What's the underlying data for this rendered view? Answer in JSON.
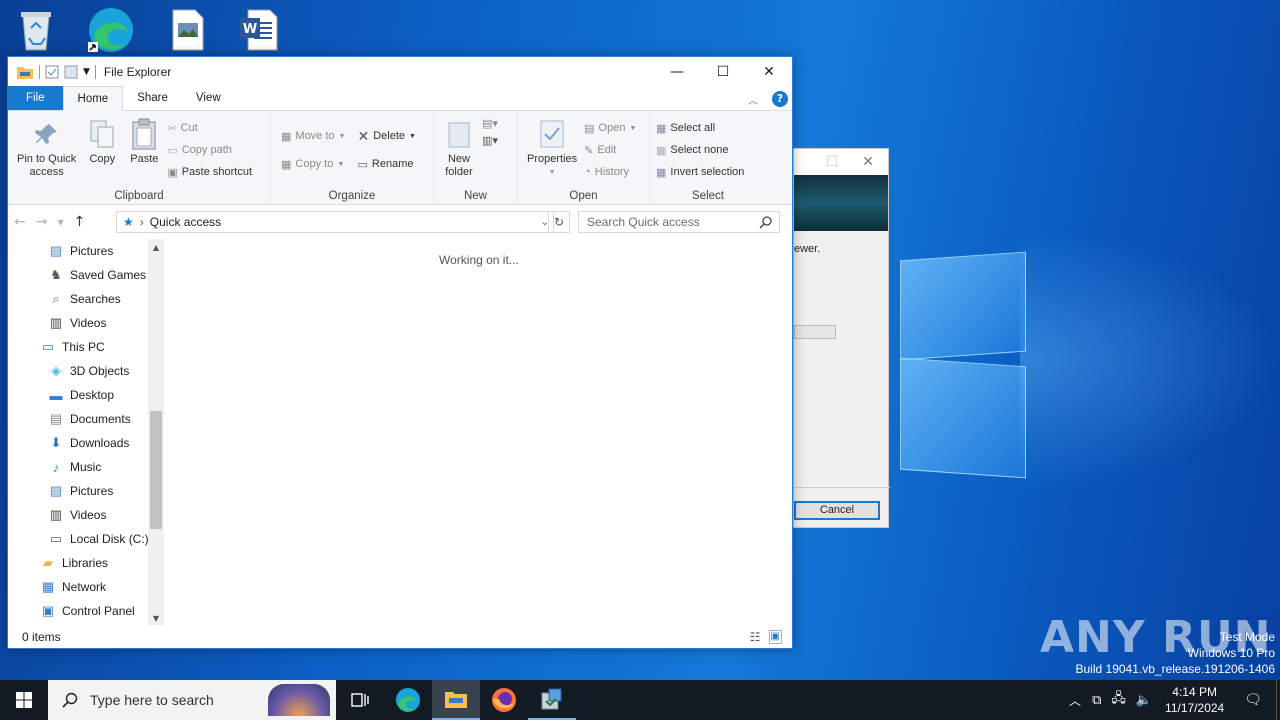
{
  "explorer": {
    "title": "File Explorer",
    "tabs": [
      "File",
      "Home",
      "Share",
      "View"
    ],
    "ribbon": {
      "clipboard": {
        "pin": "Pin to Quick\naccess",
        "copy": "Copy",
        "paste": "Paste",
        "cut": "Cut",
        "copy_path": "Copy path",
        "paste_shortcut": "Paste shortcut",
        "label": "Clipboard"
      },
      "organize": {
        "move_to": "Move to",
        "copy_to": "Copy to",
        "delete": "Delete",
        "rename": "Rename",
        "label": "Organize"
      },
      "new": {
        "new_folder": "New\nfolder",
        "label": "New"
      },
      "open": {
        "properties": "Properties",
        "open": "Open",
        "edit": "Edit",
        "history": "History",
        "label": "Open"
      },
      "select": {
        "select_all": "Select all",
        "select_none": "Select none",
        "invert": "Invert selection",
        "label": "Select"
      }
    },
    "address": "Quick access",
    "search_placeholder": "Search Quick access",
    "nav_items": [
      {
        "label": "Pictures",
        "icon": "pictures-icon",
        "indent": 1
      },
      {
        "label": "Saved Games",
        "icon": "saved-games-icon",
        "indent": 1
      },
      {
        "label": "Searches",
        "icon": "searches-icon",
        "indent": 1
      },
      {
        "label": "Videos",
        "icon": "videos-icon",
        "indent": 1
      },
      {
        "label": "This PC",
        "icon": "this-pc-icon",
        "indent": 0
      },
      {
        "label": "3D Objects",
        "icon": "3d-objects-icon",
        "indent": 1
      },
      {
        "label": "Desktop",
        "icon": "desktop-icon",
        "indent": 1
      },
      {
        "label": "Documents",
        "icon": "documents-icon",
        "indent": 1
      },
      {
        "label": "Downloads",
        "icon": "downloads-icon",
        "indent": 1
      },
      {
        "label": "Music",
        "icon": "music-icon",
        "indent": 1
      },
      {
        "label": "Pictures",
        "icon": "pictures-icon",
        "indent": 1
      },
      {
        "label": "Videos",
        "icon": "videos-icon",
        "indent": 1
      },
      {
        "label": "Local Disk (C:)",
        "icon": "local-disk-icon",
        "indent": 1
      },
      {
        "label": "Libraries",
        "icon": "libraries-icon",
        "indent": 0
      },
      {
        "label": "Network",
        "icon": "network-icon",
        "indent": 0
      },
      {
        "label": "Control Panel",
        "icon": "control-panel-icon",
        "indent": 0
      }
    ],
    "content_status": "Working on it...",
    "item_count": "0 items"
  },
  "dialog": {
    "partial_text": "ewer.",
    "cancel": "Cancel"
  },
  "taskbar": {
    "search_placeholder": "Type here to search",
    "time": "4:14 PM",
    "date": "11/17/2024"
  },
  "watermark": {
    "line1": "Test Mode",
    "line2": "Windows 10 Pro",
    "line3": "Build 19041.vb_release.191206-1406",
    "brand": "ANY RUN"
  },
  "colors": {
    "accent": "#1979ca",
    "desktop": "#0c63c9",
    "taskbar": "#121a24"
  }
}
